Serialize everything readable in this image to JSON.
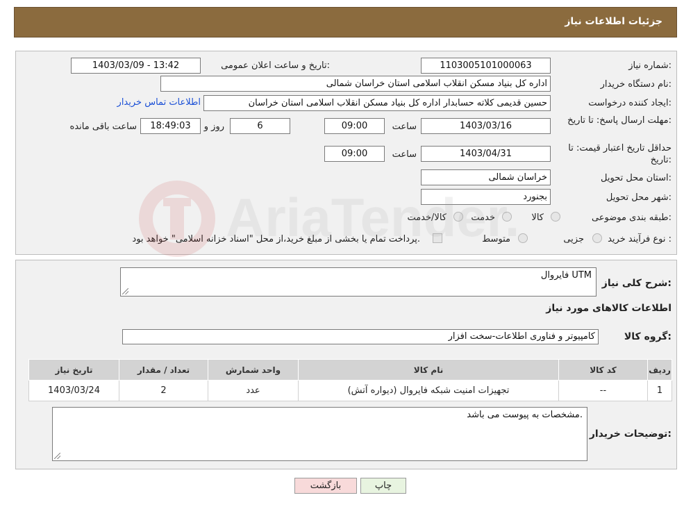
{
  "header": {
    "title": "جزئیات اطلاعات نیاز"
  },
  "form": {
    "need_number_label": "شماره نیاز:",
    "need_number": "1103005101000063",
    "announce_label": "تاریخ و ساعت اعلان عمومی:",
    "announce_value": "1403/03/09 - 13:42",
    "buyer_org_label": "نام دستگاه خریدار:",
    "buyer_org": "اداره کل بنیاد مسکن انقلاب اسلامی استان خراسان شمالی",
    "creator_label": "ایجاد کننده درخواست:",
    "creator": "حسین قدیمی کلاته حسابدار اداره کل بنیاد مسکن انقلاب اسلامی استان خراسان",
    "contact_link": "اطلاعات تماس خریدار",
    "deadline_label": "مهلت ارسال پاسخ: تا تاریخ:",
    "deadline_date": "1403/03/16",
    "time_label": "ساعت",
    "deadline_time": "09:00",
    "days_value": "6",
    "days_label": "روز و",
    "remaining_time": "18:49:03",
    "remaining_label": "ساعت باقی مانده",
    "validity_label": "حداقل تاریخ اعتبار قیمت: تا تاریخ:",
    "validity_date": "1403/04/31",
    "validity_time": "09:00",
    "province_label": "استان محل تحویل:",
    "province": "خراسان شمالی",
    "city_label": "شهر محل تحویل:",
    "city": "بجنورد",
    "category_label": "طبقه بندی موضوعی:",
    "category_options": [
      "کالا",
      "خدمت",
      "کالا/خدمت"
    ],
    "process_label": "نوع فرآیند خرید :",
    "process_options": [
      "جزیی",
      "متوسط"
    ],
    "payment_note": "پرداخت تمام یا بخشی از مبلغ خرید،از محل \"اسناد خزانه اسلامی\" خواهد بود."
  },
  "details": {
    "summary_label": "شرح کلی نیاز:",
    "summary": "فایروال UTM",
    "items_title": "اطلاعات کالاهای مورد نیاز",
    "group_label": "گروه کالا:",
    "group": "کامپیوتر و فناوری اطلاعات-سخت افزار",
    "table": {
      "headers": [
        "ردیف",
        "کد کالا",
        "نام کالا",
        "واحد شمارش",
        "تعداد / مقدار",
        "تاریخ نیاز"
      ],
      "rows": [
        [
          "1",
          "--",
          "تجهیزات امنیت شبکه فایروال (دیواره آتش)",
          "عدد",
          "2",
          "1403/03/24"
        ]
      ]
    },
    "buyer_notes_label": "توضیحات خریدار:",
    "buyer_notes": "مشخصات به پیوست می باشد."
  },
  "buttons": {
    "back": "بازگشت",
    "print": "چاپ"
  },
  "watermark": {
    "text": "AriaTender.neT"
  }
}
